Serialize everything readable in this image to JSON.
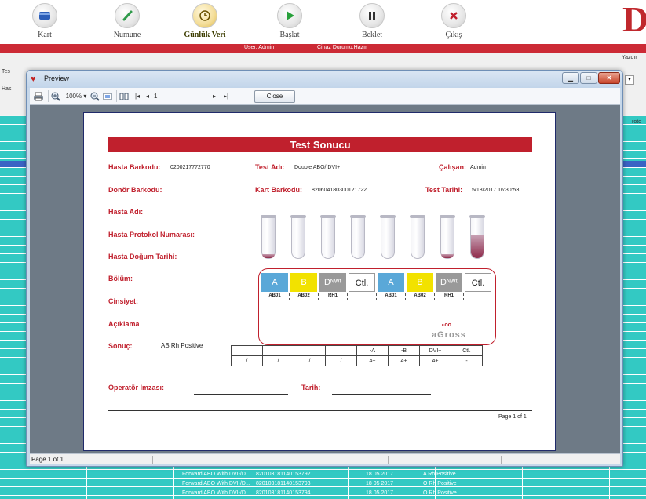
{
  "toolbar": {
    "items": [
      {
        "label": "Kart",
        "icon": "card-icon"
      },
      {
        "label": "Numune",
        "icon": "pen-icon"
      },
      {
        "label": "Günlük Veri",
        "icon": "clock-icon"
      },
      {
        "label": "Başlat",
        "icon": "play-icon"
      },
      {
        "label": "Beklet",
        "icon": "pause-icon"
      },
      {
        "label": "Çıkış",
        "icon": "close-icon"
      }
    ],
    "active_index": 2,
    "logo_letter": "D"
  },
  "status": {
    "user": "User: Admin",
    "device": "Cihaz Durumu:Hazır"
  },
  "background_app": {
    "print_label": "Yazdır",
    "side_label_a": "Tes",
    "side_label_b": "Has",
    "protocol_label": "roto",
    "rows": [
      {
        "test": "Forward ABO With DVI-/D...",
        "barcode": "820103181140153792",
        "date": "18 05 2017",
        "result": "A  Rh Positive"
      },
      {
        "test": "Forward ABO With DVI-/D...",
        "barcode": "820103181140153793",
        "date": "18 05 2017",
        "result": "O  Rh Positive"
      },
      {
        "test": "Forward ABO With DVI-/D...",
        "barcode": "820103181140153794",
        "date": "18 05 2017",
        "result": "O  Rh Positive"
      }
    ]
  },
  "preview_window": {
    "title": "Preview",
    "zoom": "100%",
    "page_input": "1",
    "close_button": "Close",
    "status_text": "Page 1 of 1",
    "colors": {
      "accent": "#c0202d",
      "grid": "#33c9c3",
      "selection": "#3a63c4"
    }
  },
  "report": {
    "title": "Test Sonucu",
    "fields": {
      "patient_barcode_label": "Hasta Barkodu:",
      "patient_barcode_value": "0200217772770",
      "test_name_label": "Test Adı:",
      "test_name_value": "Double ABO/ DVI+",
      "employee_label": "Çalışan:",
      "employee_value": "Admin",
      "donor_barcode_label": "Donör Barkodu:",
      "card_barcode_label": "Kart Barkodu:",
      "card_barcode_value": "820604180300121722",
      "test_date_label": "Test Tarihi:",
      "test_date_value": "5/18/2017 16:30:53",
      "patient_name_label": "Hasta Adı:",
      "protocol_label": "Hasta Protokol Numarası:",
      "birth_date_label": "Hasta Doğum Tarihi:",
      "department_label": "Bölüm:",
      "gender_label": "Cinsiyet:",
      "description_label": "Açıklama",
      "result_label": "Sonuç:",
      "result_value": "AB  Rh Positive",
      "operator_sign_label": "Operatör İmzası:",
      "date_label": "Tarih:",
      "page_of": "Page 1 of 1"
    },
    "tube_fill": [
      0.08,
      0.0,
      0.0,
      0.0,
      0.0,
      0.0,
      0.1,
      0.55
    ],
    "card_wells": [
      {
        "label": "A",
        "sub": "AB01",
        "color": "#5aa8d8",
        "text_color": "#ffffff"
      },
      {
        "label": "B",
        "sub": "AB02",
        "color": "#f2e200",
        "text_color": "#ffffff"
      },
      {
        "label": "Dᴺᵂᵗ",
        "sub": "RH1",
        "color": "#999999",
        "text_color": "#ffffff"
      },
      {
        "label": "Ctl.",
        "sub": "",
        "color": "#ffffff",
        "text_color": "#222222"
      },
      {
        "label": "A",
        "sub": "AB01",
        "color": "#5aa8d8",
        "text_color": "#ffffff"
      },
      {
        "label": "B",
        "sub": "AB02",
        "color": "#f2e200",
        "text_color": "#ffffff"
      },
      {
        "label": "Dᴺᵂᵗ",
        "sub": "RH1",
        "color": "#999999",
        "text_color": "#ffffff"
      },
      {
        "label": "Ctl.",
        "sub": "",
        "color": "#ffffff",
        "text_color": "#222222"
      }
    ],
    "card_brand": "aGross",
    "card_brand_dots": "∘oo",
    "result_table": {
      "headers": [
        "",
        "",
        "",
        "",
        "-A",
        "-B",
        "DVI+",
        "Ctl."
      ],
      "values": [
        "/",
        "/",
        "/",
        "/",
        "4+",
        "4+",
        "4+",
        "-"
      ]
    }
  }
}
